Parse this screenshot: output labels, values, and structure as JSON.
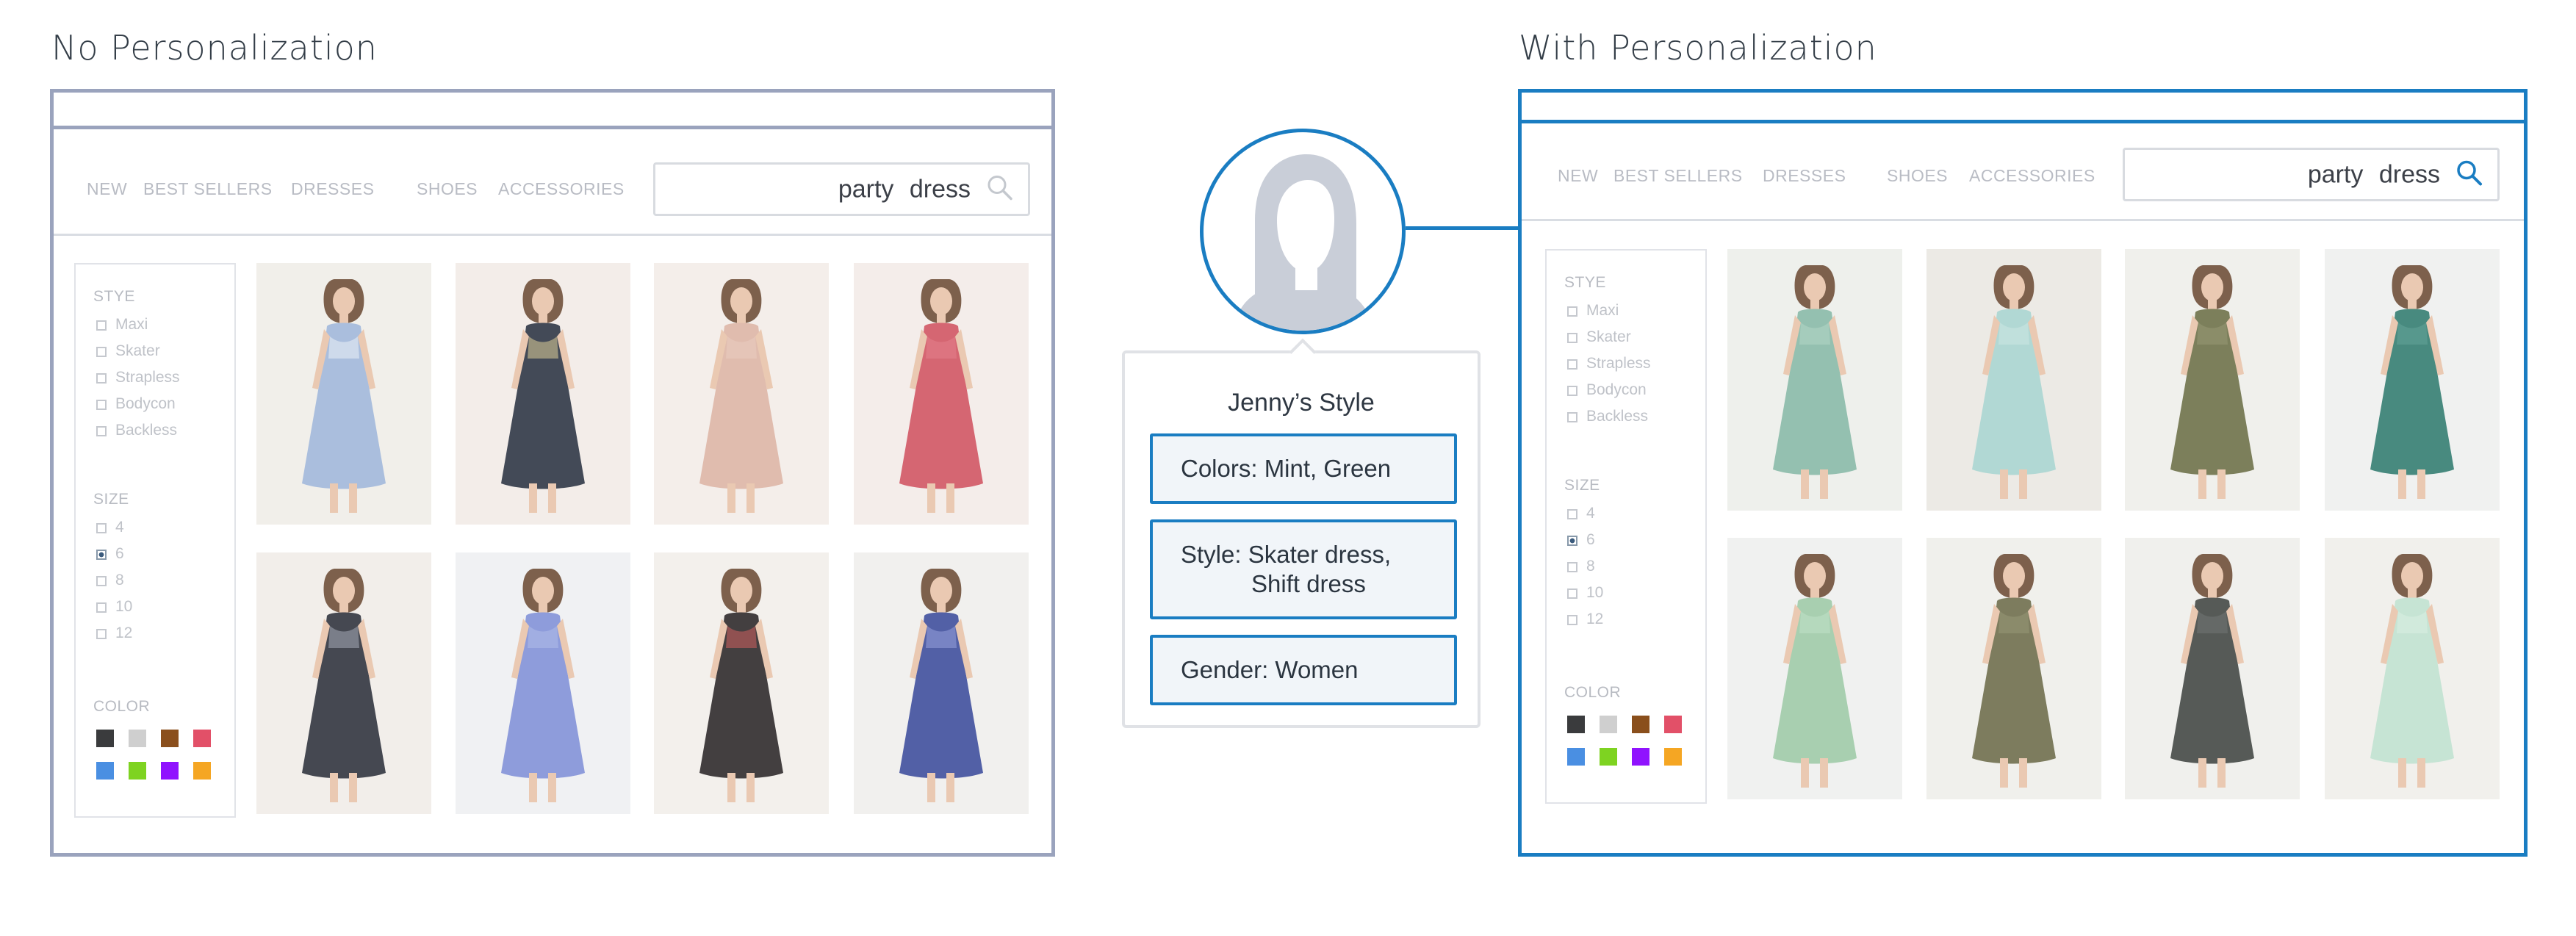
{
  "left": {
    "heading": "No Personalization",
    "nav": [
      "NEW",
      "BEST SELLERS",
      "DRESSES",
      "SHOES",
      "ACCESSORIES"
    ],
    "search_query": "party  dress",
    "search_icon": "magnifier-icon",
    "sidebar": {
      "style_heading": "STYE",
      "style_options": [
        "Maxi",
        "Skater",
        "Strapless",
        "Bodycon",
        "Backless"
      ],
      "size_heading": "SIZE",
      "size_options": [
        "4",
        "6",
        "8",
        "10",
        "12"
      ],
      "size_selected": "6",
      "color_heading": "COLOR",
      "swatches": [
        "#3a3b3d",
        "#cfcfcf",
        "#8a4f1c",
        "#e25068",
        "#4a8fe2",
        "#7ed321",
        "#9013fe",
        "#f5a623"
      ]
    },
    "products": [
      {
        "name": "blue floral wrap maxi",
        "dress": "#9fb6d9",
        "accent": "#e9eef6",
        "bg": "#efede8"
      },
      {
        "name": "navy floral off-shoulder",
        "dress": "#2a3140",
        "accent": "#d8c98a",
        "bg": "#f2ebe6"
      },
      {
        "name": "blush long-sleeve shift",
        "dress": "#dcb3a3",
        "accent": "#e8c7b9",
        "bg": "#f3ece8"
      },
      {
        "name": "red skater dress",
        "dress": "#d0515f",
        "accent": "#e06f7b",
        "bg": "#f3ebe7"
      },
      {
        "name": "black patterned shift",
        "dress": "#2c2f3a",
        "accent": "#9aa0ad",
        "bg": "#f1ece8"
      },
      {
        "name": "periwinkle maxi",
        "dress": "#7f8fd6",
        "accent": "#a8b4e6",
        "bg": "#eef0f2"
      },
      {
        "name": "black floral maxi",
        "dress": "#2a2526",
        "accent": "#c84a4a",
        "bg": "#f2eeea"
      },
      {
        "name": "navy floral halter maxi",
        "dress": "#3b4a9a",
        "accent": "#8a96d8",
        "bg": "#f0eeec"
      }
    ]
  },
  "right": {
    "heading": "With Personalization",
    "nav": [
      "NEW",
      "BEST SELLERS",
      "DRESSES",
      "SHOES",
      "ACCESSORIES"
    ],
    "search_query": "party  dress",
    "search_icon": "magnifier-icon",
    "sidebar": {
      "style_heading": "STYE",
      "style_options": [
        "Maxi",
        "Skater",
        "Strapless",
        "Bodycon",
        "Backless"
      ],
      "size_heading": "SIZE",
      "size_options": [
        "4",
        "6",
        "8",
        "10",
        "12"
      ],
      "size_selected": "6",
      "color_heading": "COLOR",
      "swatches": [
        "#3a3b3d",
        "#cfcfcf",
        "#8a4f1c",
        "#e25068",
        "#4a8fe2",
        "#7ed321",
        "#9013fe",
        "#f5a623"
      ]
    },
    "products": [
      {
        "name": "mint lace shift",
        "dress": "#86b8a5",
        "accent": "#a9d0c0",
        "bg": "#eceeea"
      },
      {
        "name": "mint off-shoulder ruffle",
        "dress": "#a7d3cf",
        "accent": "#c6e3e0",
        "bg": "#eae8e2"
      },
      {
        "name": "olive long-sleeve skater",
        "dress": "#6a6e45",
        "accent": "#8a8d63",
        "bg": "#eeeeea"
      },
      {
        "name": "teal skater dress",
        "dress": "#2f7a6e",
        "accent": "#4f988c",
        "bg": "#eef0ee"
      },
      {
        "name": "mint skater dress",
        "dress": "#9cc9a6",
        "accent": "#b8dcbf",
        "bg": "#eef0ee"
      },
      {
        "name": "olive t-shirt dress",
        "dress": "#6b6a48",
        "accent": "#8a8965",
        "bg": "#eeeeea"
      },
      {
        "name": "charcoal t-shirt dress",
        "dress": "#3f4440",
        "accent": "#5e6460",
        "bg": "#eeeeeb"
      },
      {
        "name": "light mint skater",
        "dress": "#bfe1cf",
        "accent": "#d5ece0",
        "bg": "#efeeea"
      }
    ]
  },
  "profile": {
    "avatar_icon": "user-silhouette-icon",
    "title": "Jenny’s Style",
    "colors": "Colors: Mint, Green",
    "style_line1": "Style: Skater dress,",
    "style_line2": "Shift dress",
    "gender": "Gender: Women"
  },
  "colors": {
    "accent_blue": "#1a7dc2",
    "muted_frame": "#9aa3bd"
  }
}
